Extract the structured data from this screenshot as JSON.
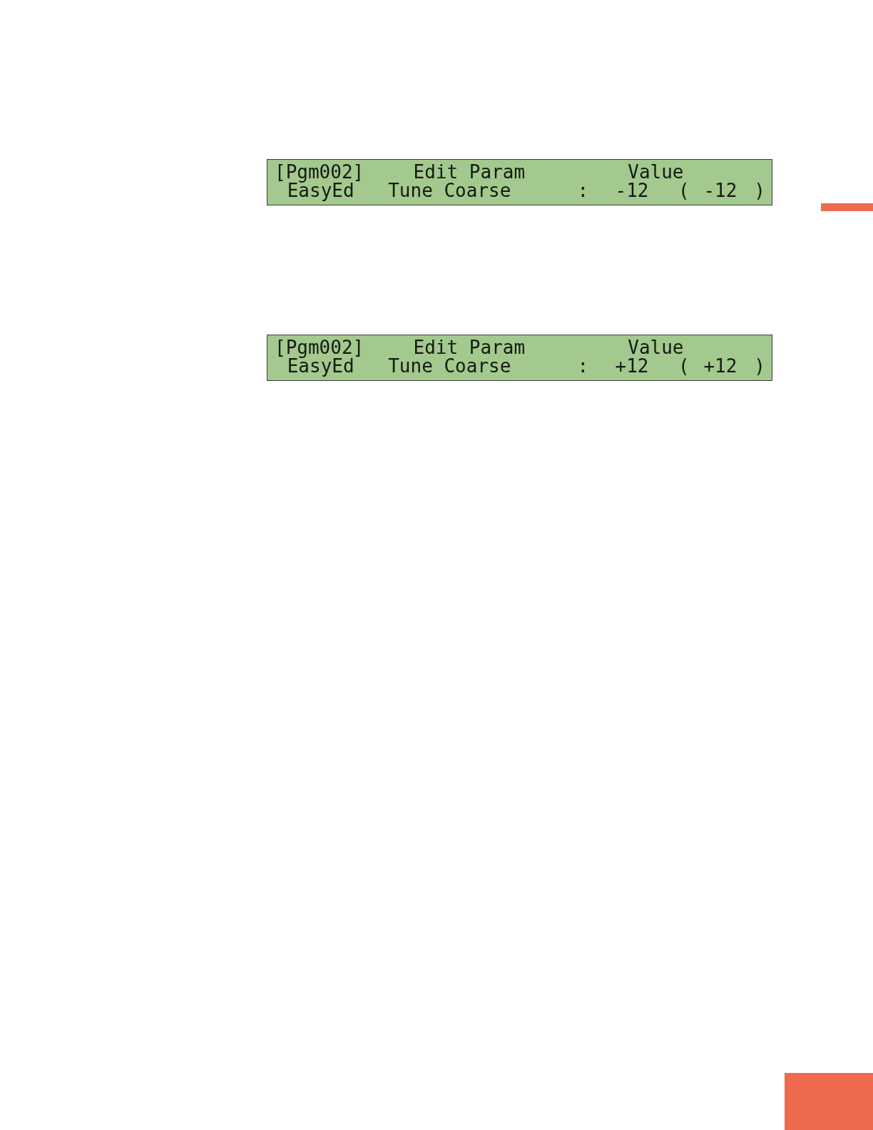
{
  "displays": [
    {
      "line_1": [
        "[Pgm002]",
        "Edit Param",
        "Value"
      ],
      "line_2": [
        "EasyEd",
        "Tune Coarse",
        ":",
        "-12",
        "(",
        "-12",
        ")"
      ]
    },
    {
      "line_1": [
        "[Pgm002]",
        "Edit Param",
        "Value"
      ],
      "line_2": [
        "EasyEd",
        "Tune Coarse",
        ":",
        "+12",
        "(",
        "+12",
        ")"
      ]
    }
  ]
}
